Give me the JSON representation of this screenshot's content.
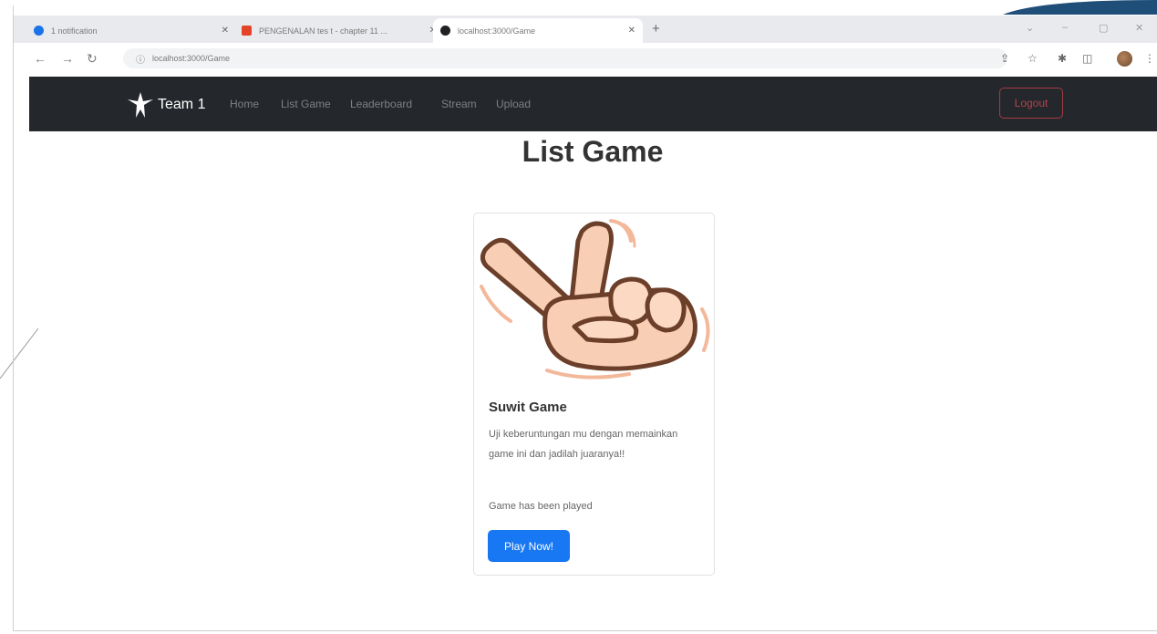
{
  "browser": {
    "tabs": [
      {
        "label": "1 notification",
        "icon": "chat-icon",
        "color": "#1a73e8"
      },
      {
        "label": "PENGENALAN tes t - chapter 11 ...",
        "icon": "gitlab-icon",
        "color": "#e24329"
      },
      {
        "label": "localhost:3000/Game",
        "icon": "react-icon",
        "color": "#202124"
      }
    ],
    "new_tab": "+",
    "url": "localhost:3000/Game"
  },
  "navbar": {
    "brand": "Team 1",
    "links": [
      "Home",
      "List Game",
      "Leaderboard",
      "Stream",
      "Upload"
    ],
    "logout": "Logout"
  },
  "main": {
    "title": "List Game",
    "card": {
      "title": "Suwit Game",
      "description": "Uji keberuntungan mu dengan memainkan game ini dan jadilah juaranya!!",
      "status": "Game has been played",
      "button": "Play Now!"
    }
  },
  "colors": {
    "navbar_bg": "#24272b",
    "primary": "#1877f2",
    "danger": "#b5424c",
    "accent_corner": "#1f4e79"
  }
}
